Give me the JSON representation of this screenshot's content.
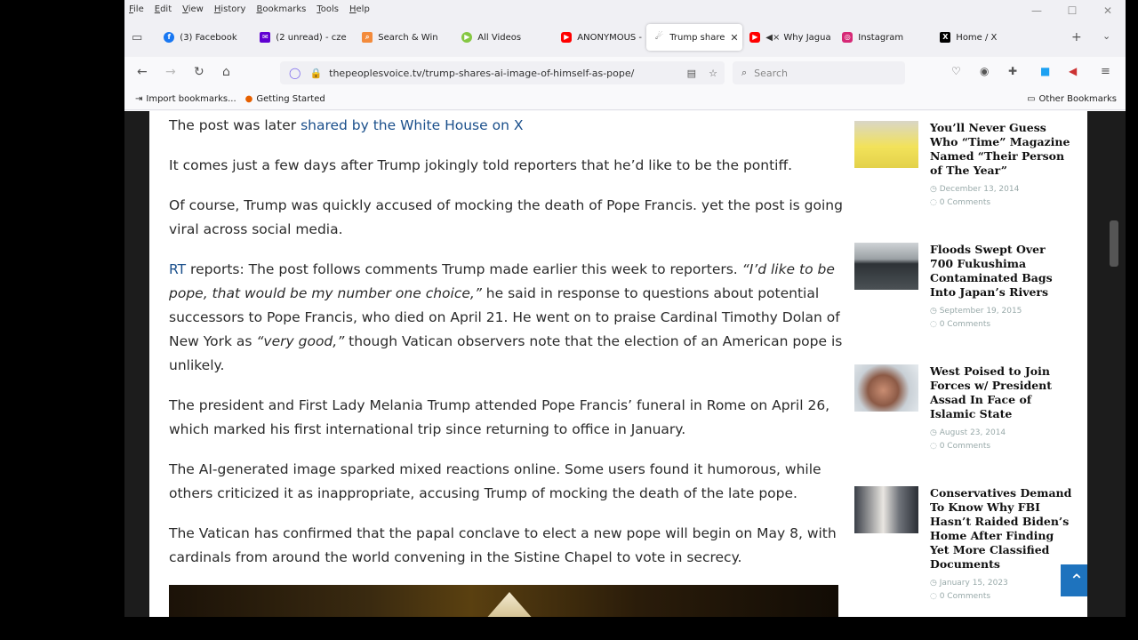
{
  "menubar": [
    "File",
    "Edit",
    "View",
    "History",
    "Bookmarks",
    "Tools",
    "Help"
  ],
  "tabs": [
    {
      "label": "(3) Facebook",
      "icon": "facebook-icon",
      "color": "#1877f2"
    },
    {
      "label": "(2 unread) - cze",
      "icon": "mail-icon",
      "color": "#6001d2"
    },
    {
      "label": "Search & Win",
      "icon": "search-win-icon",
      "color": "#f38b3c"
    },
    {
      "label": "All Videos",
      "icon": "rumble-icon",
      "color": "#85c742"
    },
    {
      "label": "ANONYMOUS -",
      "icon": "youtube-icon",
      "color": "#ff0000"
    },
    {
      "label": "Trump share",
      "icon": "site-icon",
      "color": "#333333",
      "active": true
    },
    {
      "label": "Why Jagua",
      "icon": "youtube-icon",
      "color": "#ff0000"
    },
    {
      "label": "Instagram",
      "icon": "instagram-icon",
      "color": "#d62976"
    },
    {
      "label": "Home / X",
      "icon": "x-icon",
      "color": "#000000"
    }
  ],
  "url": "thepeoplesvoice.tv/trump-shares-ai-image-of-himself-as-pope/",
  "search_placeholder": "Search",
  "bookmarks": {
    "import": "Import bookmarks...",
    "getting_started": "Getting Started",
    "other": "Other Bookmarks"
  },
  "article": {
    "p1_pre": "The post was later ",
    "p1_link": "shared by the White House on X",
    "p2": "It comes just a few days after Trump jokingly told reporters that he’d like to be the pontiff.",
    "p3": "Of course, Trump was quickly accused of mocking the death of Pope Francis. yet the post is going viral across social media.",
    "p4_link": "RT",
    "p4_a": " reports: The post follows comments Trump made earlier this week to reporters. ",
    "p4_quote1": "“I’d like to be pope, that would be my number one choice,”",
    "p4_b": " he said in response to questions about potential successors to Pope Francis, who died on April 21. He went on to praise Cardinal Timothy Dolan of New York as ",
    "p4_quote2": "“very good,”",
    "p4_c": " though Vatican observers note that the election of an American pope is unlikely.",
    "p5": "The president and First Lady Melania Trump attended Pope Francis’ funeral in Rome on April 26, which marked his first international trip since returning to office in January.",
    "p6": "The AI-generated image sparked mixed reactions online. Some users found it humorous, while others criticized it as inappropriate, accusing Trump of mocking the death of the late pope.",
    "p7": "The Vatican has confirmed that the papal conclave to elect a new pope will begin on May 8, with cardinals from around the world convening in the Sistine Chapel to vote in secrecy."
  },
  "sidebar": [
    {
      "title": "You’ll Never Guess Who “Time” Magazine Named “Their Person of The Year”",
      "date": "December 13, 2014",
      "comments": "0 Comments"
    },
    {
      "title": "Floods Swept Over 700 Fukushima Contaminated Bags Into Japan’s Rivers",
      "date": "September 19, 2015",
      "comments": "0 Comments"
    },
    {
      "title": "West Poised to Join Forces w/ President Assad In Face of Islamic State",
      "date": "August 23, 2014",
      "comments": "0 Comments"
    },
    {
      "title": "Conservatives Demand To Know Why FBI Hasn’t Raided Biden’s Home After Finding Yet More Classified Documents",
      "date": "January 15, 2023",
      "comments": "0 Comments"
    }
  ]
}
